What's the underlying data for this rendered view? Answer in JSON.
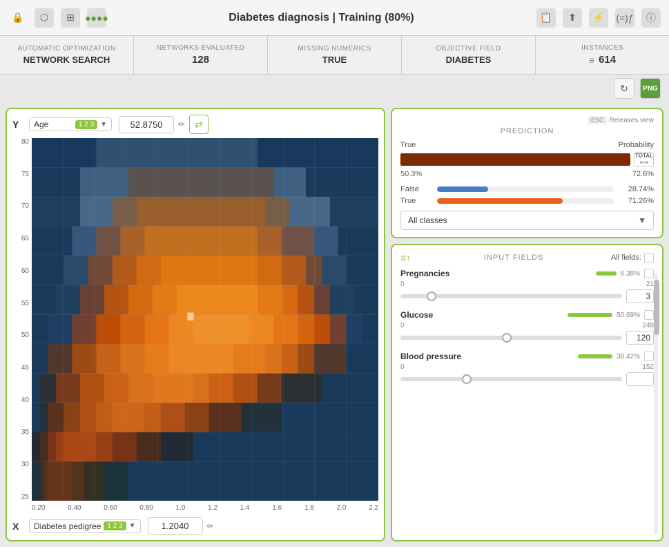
{
  "topbar": {
    "title": "Diabetes diagnosis | Training (80%)"
  },
  "infobar": {
    "cells": [
      {
        "label": "AUTOMATIC OPTIMIZATION",
        "value": "NETWORK SEARCH"
      },
      {
        "label": "NETWORKS EVALUATED",
        "value": "128"
      },
      {
        "label": "MISSING NUMERICS",
        "value": "TRUE"
      },
      {
        "label": "OBJECTIVE FIELD",
        "value": "DIABETES"
      },
      {
        "label": "INSTANCES",
        "value": "614"
      }
    ]
  },
  "leftpanel": {
    "y_axis_label": "Y",
    "y_field": "Age",
    "y_badge": "1 2 3",
    "y_value": "52.8750",
    "x_axis_label": "X",
    "x_field": "Diabetes pedigree",
    "x_badge": "1 2 3",
    "x_value": "1.2040",
    "y_ticks": [
      "80",
      "75",
      "70",
      "65",
      "60",
      "55",
      "50",
      "45",
      "40",
      "35",
      "30",
      "25"
    ],
    "x_ticks": [
      "0.20",
      "0.40",
      "0.60",
      "0.80",
      "1.0",
      "1.2",
      "1.4",
      "1.6",
      "1.8",
      "2.0",
      "2.2"
    ]
  },
  "prediction": {
    "panel_title": "PREDICTION",
    "esc_label": "ESC",
    "releases_text": "Releases view",
    "header_true": "True",
    "header_probability": "Probability",
    "main_pct": "50.3%",
    "main_prob": "72.6%",
    "classes": [
      {
        "name": "False",
        "pct": "28.74%",
        "color": "blue",
        "width": 28.74
      },
      {
        "name": "True",
        "pct": "71.26%",
        "color": "orange",
        "width": 71.26
      }
    ],
    "dropdown_label": "All classes",
    "dropdown_arrow": "▼"
  },
  "inputfields": {
    "panel_title": "INPUT FIELDS",
    "all_fields_label": "All fields:",
    "sort_icon": "≡↑",
    "fields": [
      {
        "name": "Pregnancies",
        "pct": "6.38%",
        "pct_width": 30,
        "min": "0",
        "max": "21",
        "value": "3",
        "thumb_pos": 14
      },
      {
        "name": "Glucose",
        "pct": "50.69%",
        "pct_width": 65,
        "min": "0",
        "max": "248",
        "value": "120",
        "thumb_pos": 48
      },
      {
        "name": "Blood pressure",
        "pct": "38.42%",
        "pct_width": 50,
        "min": "0",
        "max": "152",
        "value": "",
        "thumb_pos": 30
      }
    ]
  }
}
